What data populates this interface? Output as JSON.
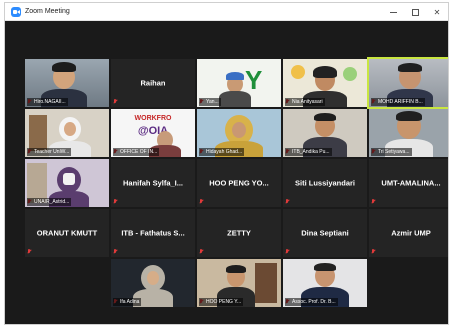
{
  "window": {
    "title": "Zoom Meeting",
    "colors": {
      "accent": "#2d8cff",
      "background": "#1a1a1a",
      "tile": "#242424",
      "mute": "#e03a3a"
    }
  },
  "row1": {
    "t1": {
      "tag": "Hiro.NAGAII..."
    },
    "t2": {
      "name": "Raihan"
    },
    "t3": {
      "tag": "Yan...",
      "logo": "Y"
    },
    "t4": {
      "tag": "Nia Anityasari"
    },
    "t5": {
      "tag": "MOHD ARIFFIN B..."
    }
  },
  "row2": {
    "t1": {
      "tag": "Teacher UniW..."
    },
    "t2": {
      "tag": "OFFICE OF IN...",
      "logo_top": "WORKFRO",
      "logo_bottom": "@OIA"
    },
    "t3": {
      "tag": "Hidayah Ghad..."
    },
    "t4": {
      "tag": "ITB_Andika Pu..."
    },
    "t5": {
      "tag": "Tri Setiyawa..."
    }
  },
  "row3": {
    "t1": {
      "tag": "UNAIR_Astrid..."
    },
    "t2": {
      "name": "Hanifah Sylfa_I..."
    },
    "t3": {
      "name": "HOO PENG YO..."
    },
    "t4": {
      "name": "Siti Lussiyandari"
    },
    "t5": {
      "name": "UMT-AMALINA..."
    }
  },
  "row4": {
    "t1": {
      "name": "ORANUT KMUTT"
    },
    "t2": {
      "name": "ITB - Fathatus S..."
    },
    "t3": {
      "name": "ZETTY"
    },
    "t4": {
      "name": "Dina Septiani"
    },
    "t5": {
      "name": "Azmir UMP"
    }
  },
  "row5": {
    "t1": {
      "tag": "Ifa Adina"
    },
    "t2": {
      "tag": "HOO PENG Y..."
    },
    "t3": {
      "tag": "Assoc. Prof. Dr. B..."
    }
  }
}
